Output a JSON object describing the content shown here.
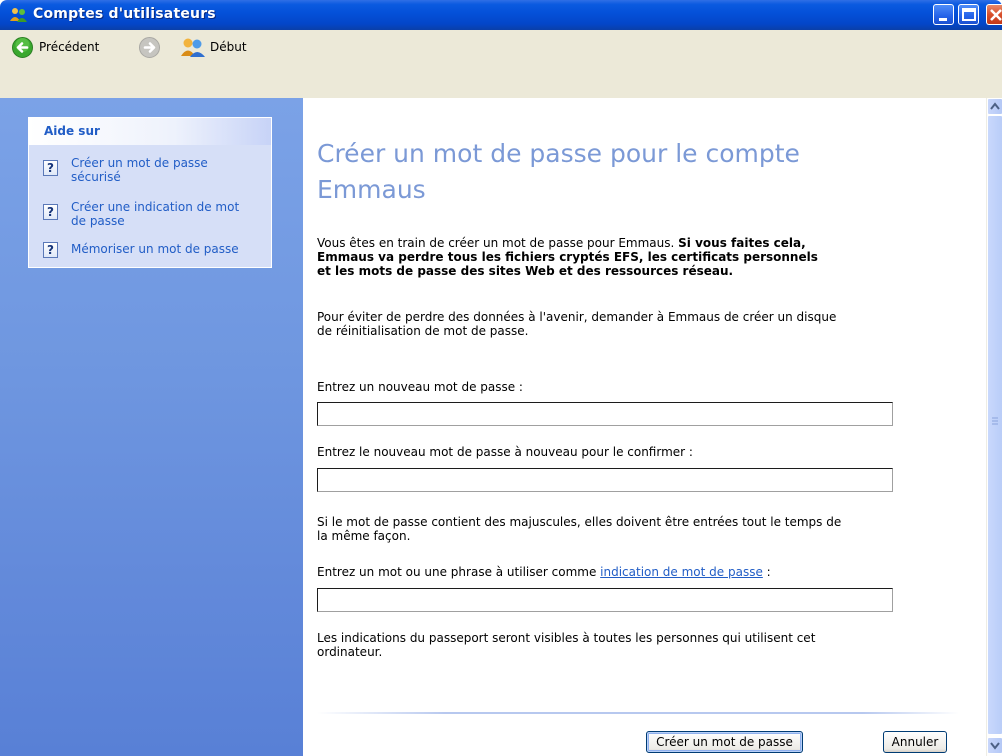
{
  "window": {
    "title": "Comptes d'utilisateurs"
  },
  "toolbar": {
    "back_label": "Précédent",
    "home_label": "Début"
  },
  "sidebar": {
    "help_title": "Aide sur",
    "items": [
      {
        "label_line1": "Créer un mot de passe",
        "label_line2": "sécurisé"
      },
      {
        "label_line1": "Créer une indication de mot",
        "label_line2": "de passe"
      },
      {
        "label_line1": "Mémoriser un mot de passe",
        "label_line2": ""
      }
    ]
  },
  "content": {
    "heading_line1": "Créer un mot de passe pour le compte",
    "heading_line2": "Emmaus",
    "warning_normal": "Vous êtes en train de créer un mot de passe pour Emmaus. ",
    "warning_bold_line1": "Si vous faites cela,",
    "warning_bold_line2": "Emmaus va perdre tous les fichiers cryptés EFS, les certificats personnels",
    "warning_bold_line3": "et les mots de passe des sites Web et des ressources réseau.",
    "reset_line1": "Pour éviter de perdre des données à l'avenir, demander à Emmaus de créer un disque",
    "reset_line2": "de réinitialisation de mot de passe.",
    "new_password_label": "Entrez un nouveau mot de passe :",
    "new_password_value": "",
    "confirm_label": "Entrez le nouveau mot de passe à nouveau pour le confirmer :",
    "confirm_value": "",
    "case_line1": "Si le mot de passe contient des majuscules, elles doivent être entrées tout le temps de",
    "case_line2": "la même façon.",
    "hint_label_prefix": "Entrez un mot ou une phrase à utiliser comme ",
    "hint_link": "indication de mot de passe",
    "hint_label_suffix": " :",
    "hint_value": "",
    "hint_note_line1": "Les indications du passeport seront visibles à toutes les personnes qui utilisent cet",
    "hint_note_line2": "ordinateur.",
    "create_button": "Créer un mot de passe",
    "cancel_button": "Annuler"
  },
  "colors": {
    "link": "#215dc6",
    "heading": "#7b99d6",
    "sidebar": "#6f97e0"
  }
}
